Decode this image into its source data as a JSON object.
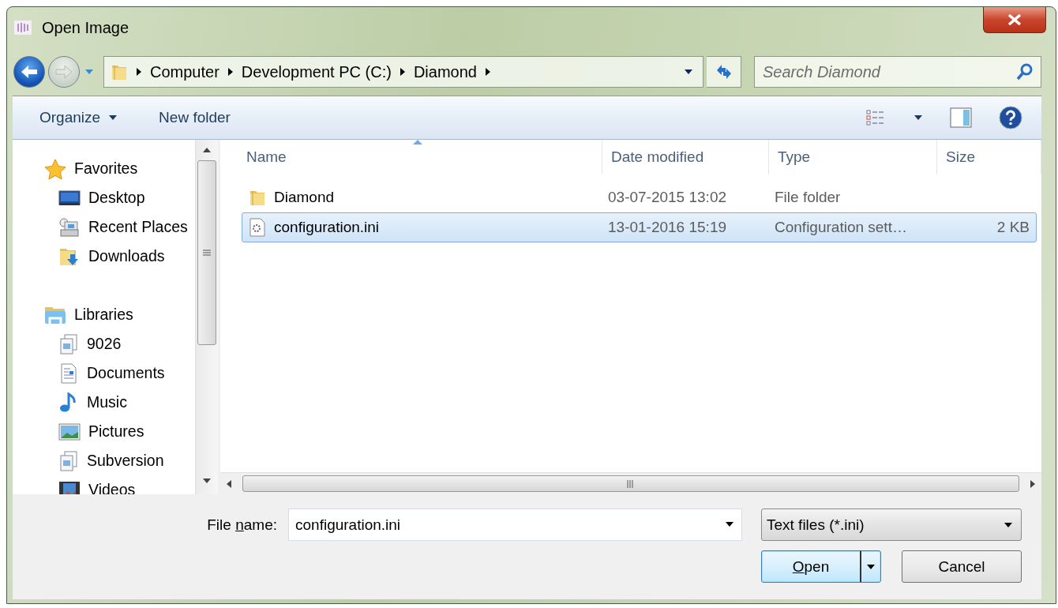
{
  "window": {
    "title": "Open Image"
  },
  "address_bar": {
    "segments": [
      "Computer",
      "Development PC (C:)",
      "Diamond"
    ]
  },
  "search": {
    "placeholder": "Search Diamond"
  },
  "toolbar": {
    "items": [
      {
        "label": "Organize",
        "has_menu": true
      },
      {
        "label": "New folder",
        "has_menu": false
      }
    ]
  },
  "nav_pane": {
    "groups": [
      {
        "label": "Favorites",
        "kind": "favorites",
        "children": [
          {
            "label": "Desktop",
            "kind": "desktop"
          },
          {
            "label": "Recent Places",
            "kind": "recent"
          },
          {
            "label": "Downloads",
            "kind": "downloads"
          }
        ]
      },
      {
        "label": "Libraries",
        "kind": "libraries",
        "children": [
          {
            "label": "9026",
            "kind": "library"
          },
          {
            "label": "Documents",
            "kind": "documents"
          },
          {
            "label": "Music",
            "kind": "music"
          },
          {
            "label": "Pictures",
            "kind": "pictures"
          },
          {
            "label": "Subversion",
            "kind": "library"
          },
          {
            "label": "Videos",
            "kind": "videos"
          }
        ]
      }
    ]
  },
  "file_list": {
    "columns": [
      {
        "label": "Name",
        "sorted": true
      },
      {
        "label": "Date modified",
        "sorted": false
      },
      {
        "label": "Type",
        "sorted": false
      },
      {
        "label": "Size",
        "sorted": false
      }
    ],
    "rows": [
      {
        "kind": "folder",
        "name": "Diamond",
        "date": "03-07-2015 13:02",
        "type": "File folder",
        "selected": false
      },
      {
        "kind": "file",
        "name": "configuration.ini",
        "date": "13-01-2016 15:19",
        "type": "Configuration sett…",
        "size": "2 KB",
        "selected": true
      }
    ]
  },
  "footer": {
    "file_name_label": [
      {
        "text": "File ",
        "underline": false
      },
      {
        "text": "n",
        "underline": true
      },
      {
        "text": "ame:",
        "underline": false
      }
    ],
    "file_name": "configuration.ini",
    "filter": "Text files (*.ini)",
    "buttons": [
      {
        "kind": "split",
        "default": true,
        "label": [
          {
            "text": "O",
            "underline": true
          },
          {
            "text": "pen",
            "underline": false
          }
        ]
      },
      {
        "kind": "plain",
        "default": false,
        "label": [
          {
            "text": "Cancel",
            "underline": false
          }
        ]
      }
    ]
  }
}
